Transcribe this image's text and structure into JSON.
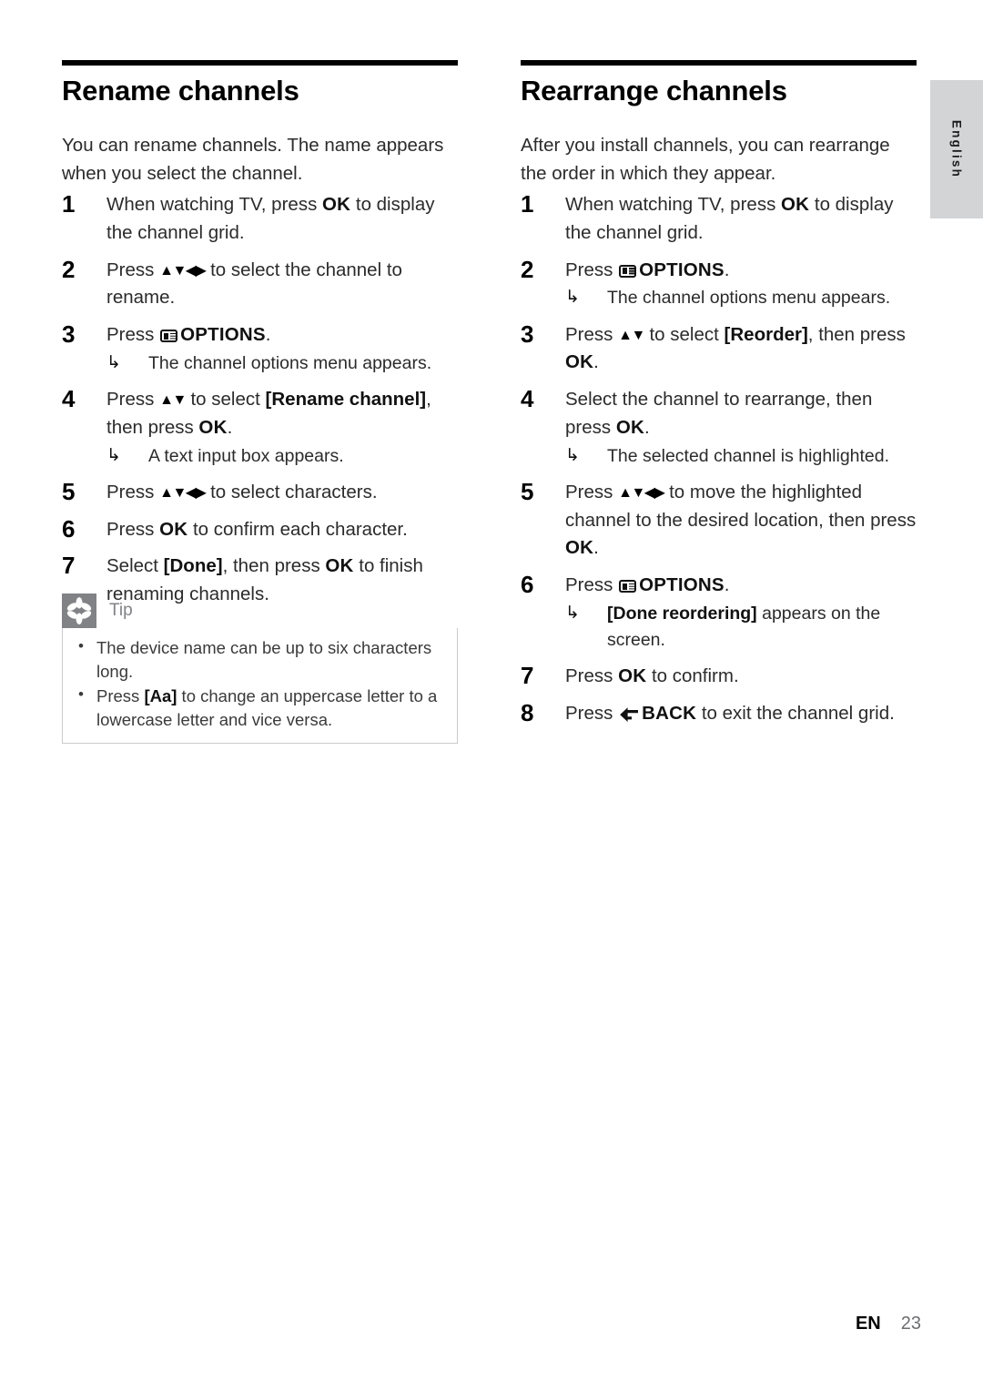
{
  "document": {
    "language_tab": "English",
    "footer": {
      "locale": "EN",
      "page_number": "23"
    }
  },
  "left_column": {
    "title": "Rename channels",
    "intro": "You can rename channels. The name appears when you select the channel.",
    "steps": [
      {
        "number": "1",
        "text_before": "When watching TV, press ",
        "key": "OK",
        "text_after": " to display the channel grid."
      },
      {
        "number": "2",
        "text_before": "Press ",
        "nav": "▲▼◀▶",
        "text_after": " to select the channel to rename."
      },
      {
        "number": "3",
        "text_before": "Press ",
        "icon": "options-icon",
        "key": "OPTIONS",
        "text_after": ".",
        "result": "The channel options menu appears."
      },
      {
        "number": "4",
        "text_before": "Press ",
        "nav": "▲▼",
        "text_mid": " to select ",
        "menu_item": "[Rename channel]",
        "text_mid2": ", then press ",
        "key": "OK",
        "text_after": ".",
        "result": "A text input box appears."
      },
      {
        "number": "5",
        "text_before": "Press ",
        "nav": "▲▼◀▶",
        "text_after": " to select characters."
      },
      {
        "number": "6",
        "text_before": "Press ",
        "key": "OK",
        "text_after": " to confirm each character."
      },
      {
        "number": "7",
        "text_before": "Select ",
        "menu_item": "[Done]",
        "text_mid2": ", then press ",
        "key": "OK",
        "text_after": " to finish renaming channels."
      }
    ],
    "tip": {
      "label": "Tip",
      "items": [
        {
          "text_before": "The device name can be up to six characters long."
        },
        {
          "text_before": "Press ",
          "menu_item": "[Aa]",
          "text_after": " to change an uppercase letter to a lowercase letter and vice versa."
        }
      ]
    }
  },
  "right_column": {
    "title": "Rearrange channels",
    "intro": "After you install channels, you can rearrange the order in which they appear.",
    "steps": [
      {
        "number": "1",
        "text_before": "When watching TV, press ",
        "key": "OK",
        "text_after": " to display the channel grid."
      },
      {
        "number": "2",
        "text_before": "Press ",
        "icon": "options-icon",
        "key": "OPTIONS",
        "text_after": ".",
        "result": "The channel options menu appears."
      },
      {
        "number": "3",
        "text_before": "Press ",
        "nav": "▲▼",
        "text_mid": " to select ",
        "menu_item": "[Reorder]",
        "text_mid2": ", then press ",
        "key": "OK",
        "text_after": "."
      },
      {
        "number": "4",
        "text_before": "Select the channel to rearrange, then press ",
        "key": "OK",
        "text_after": ".",
        "result": "The selected channel is highlighted."
      },
      {
        "number": "5",
        "text_before": "Press ",
        "nav": "▲▼◀▶",
        "text_mid": " to move the highlighted channel to the desired location, then press ",
        "key": "OK",
        "text_after": "."
      },
      {
        "number": "6",
        "text_before": "Press ",
        "icon": "options-icon",
        "key": "OPTIONS",
        "text_after": ".",
        "result_menu_item": "[Done reordering]",
        "result_after": " appears on the screen."
      },
      {
        "number": "7",
        "text_before": "Press ",
        "key": "OK",
        "text_after": " to confirm."
      },
      {
        "number": "8",
        "text_before": "Press ",
        "icon": "back-icon",
        "key": "BACK",
        "text_after": " to exit the channel grid."
      }
    ]
  }
}
